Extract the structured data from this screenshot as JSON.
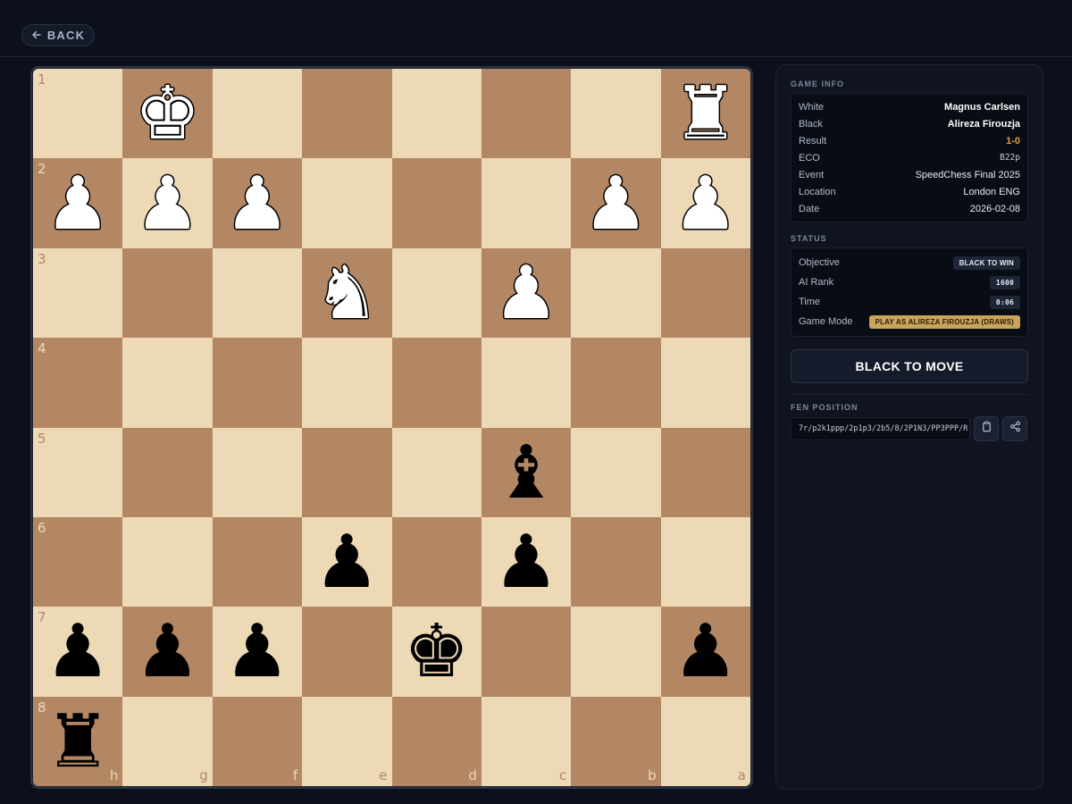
{
  "nav": {
    "back_label": "BACK",
    "back_icon": "arrow-left-icon"
  },
  "board": {
    "ranks": [
      "1",
      "2",
      "3",
      "4",
      "5",
      "6",
      "7",
      "8"
    ],
    "files": [
      "h",
      "g",
      "f",
      "e",
      "d",
      "c",
      "b",
      "a"
    ],
    "colors": {
      "light": "#eed9b7",
      "dark": "#b48764"
    },
    "squares": [
      [
        "",
        "wk",
        "",
        "",
        "",
        "",
        "",
        "wr"
      ],
      [
        "wp",
        "wp",
        "wp",
        "",
        "",
        "",
        "wp",
        "wp"
      ],
      [
        "",
        "",
        "",
        "wn",
        "",
        "wp",
        "",
        ""
      ],
      [
        "",
        "",
        "",
        "",
        "",
        "",
        "",
        ""
      ],
      [
        "",
        "",
        "",
        "",
        "",
        "bb",
        "",
        ""
      ],
      [
        "",
        "",
        "",
        "bp",
        "",
        "bp",
        "",
        ""
      ],
      [
        "bp",
        "bp",
        "bp",
        "",
        "bk",
        "",
        "",
        "bp"
      ],
      [
        "br",
        "",
        "",
        "",
        "",
        "",
        "",
        ""
      ]
    ]
  },
  "game_info": {
    "title": "GAME INFO",
    "rows": [
      {
        "key": "White",
        "value": "Magnus Carlsen"
      },
      {
        "key": "Black",
        "value": "Alireza Firouzja"
      },
      {
        "key": "Result",
        "value": "1-0"
      },
      {
        "key": "ECO",
        "value": "B22p"
      },
      {
        "key": "Event",
        "value": "SpeedChess Final 2025"
      },
      {
        "key": "Location",
        "value": "London ENG"
      },
      {
        "key": "Date",
        "value": "2026-02-08"
      }
    ]
  },
  "status": {
    "title": "STATUS",
    "rows": [
      {
        "key": "Objective",
        "value": "BLACK TO WIN"
      },
      {
        "key": "AI Rank",
        "value": "1600"
      },
      {
        "key": "Time",
        "value": "0:06"
      },
      {
        "key": "Game Mode",
        "value": "PLAY AS ALIREZA FIROUZJA (DRAWS)"
      }
    ]
  },
  "to_move": "BLACK TO MOVE",
  "fen": {
    "title": "FEN POSITION",
    "value": "7r/p2k1ppp/2p1p3/2b5/8/2P1N3/PP3PPP/R",
    "copy_icon": "clipboard-icon",
    "share_icon": "share-icon"
  }
}
